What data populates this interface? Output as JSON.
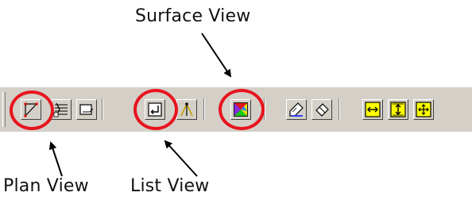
{
  "callouts": {
    "surface_view": "Surface View",
    "plan_view": "Plan View",
    "list_view": "List View"
  },
  "toolbar": {
    "buttons": [
      {
        "name": "plan-view",
        "icon": "polyline-icon",
        "highlighted": true
      },
      {
        "name": "layers",
        "icon": "layers-icon",
        "highlighted": false
      },
      {
        "name": "frame",
        "icon": "frame-icon",
        "highlighted": false
      },
      {
        "name": "list-view",
        "icon": "list-return-icon",
        "highlighted": true
      },
      {
        "name": "tripod",
        "icon": "tripod-icon",
        "highlighted": false
      },
      {
        "name": "surface-view",
        "icon": "surface-color-icon",
        "highlighted": true
      },
      {
        "name": "draw",
        "icon": "pen-icon",
        "highlighted": false
      },
      {
        "name": "erase",
        "icon": "eraser-icon",
        "highlighted": false
      },
      {
        "name": "fit-horizontal",
        "icon": "horizontal-arrows-icon",
        "highlighted": false
      },
      {
        "name": "fit-vertical",
        "icon": "vertical-arrows-icon",
        "highlighted": false
      },
      {
        "name": "fit-all",
        "icon": "four-way-arrows-icon",
        "highlighted": false
      }
    ]
  },
  "colors": {
    "highlight_ring": "#e8141e",
    "toolbar_face": "#d4d0c8",
    "fit_icon_fill": "#ffff00"
  }
}
